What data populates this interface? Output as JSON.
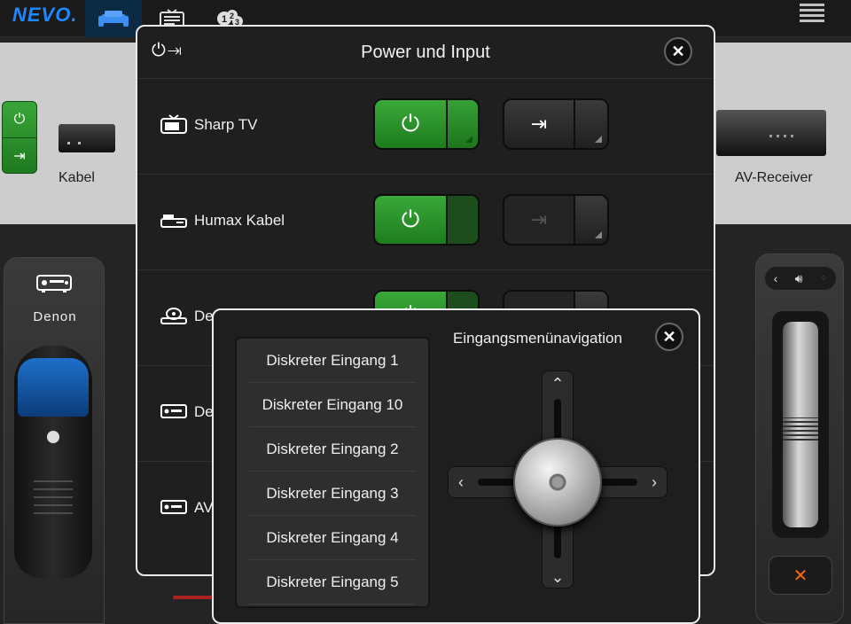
{
  "app": {
    "logo": "NEVO."
  },
  "topbar": {
    "tabs": [
      {
        "icon": "sofa-icon",
        "active": true
      },
      {
        "icon": "tv-guide-icon",
        "active": false
      },
      {
        "icon": "numbers-icon",
        "active": false
      }
    ]
  },
  "activities": {
    "left_label": "Kabel",
    "right_label": "AV-Receiver"
  },
  "device_panel": {
    "label": "Denon"
  },
  "power_dialog": {
    "title": "Power und Input",
    "rows": [
      {
        "label": "Sharp TV",
        "icon": "tv-icon",
        "input_enabled": true
      },
      {
        "label": "Humax Kabel",
        "icon": "settop-box-icon",
        "input_enabled": false
      },
      {
        "label": "Denon Blu",
        "icon": "disc-player-icon",
        "input_enabled": false
      },
      {
        "label": "De",
        "icon": "receiver-icon",
        "input_enabled": false
      },
      {
        "label": "AV",
        "icon": "receiver-icon",
        "input_enabled": false
      }
    ]
  },
  "input_dialog": {
    "title": "Eingangsmenünavigation",
    "items": [
      "Diskreter Eingang 1",
      "Diskreter Eingang 10",
      "Diskreter Eingang 2",
      "Diskreter Eingang 3",
      "Diskreter Eingang 4",
      "Diskreter Eingang 5"
    ]
  },
  "colors": {
    "accent": "#1e88ff",
    "power_green": "#2e9a2e",
    "mute_orange": "#ff6a00"
  }
}
